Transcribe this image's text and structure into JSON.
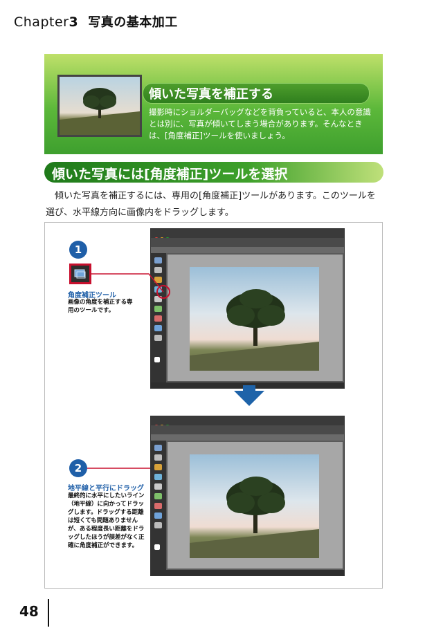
{
  "header": {
    "chapter_label": "Chapter",
    "chapter_number": "3",
    "chapter_title": "写真の基本加工"
  },
  "banner": {
    "title": "傾いた写真を補正する",
    "body": "撮影時にショルダーバッグなどを背負っていると、本人の意識とは別に、写真が傾いてしまう場合があります。そんなときは、[角度補正]ツールを使いましょう。"
  },
  "section": {
    "title": "傾いた写真には[角度補正]ツールを選択",
    "body": "傾いた写真を補正するには、専用の[角度補正]ツールがあります。このツールを選び、水平線方向に画像内をドラッグします。"
  },
  "figure": {
    "step1": {
      "number": "1",
      "title": "角度補正ツール",
      "body": "画像の角度を補正する専用のツールです。"
    },
    "step2": {
      "number": "2",
      "title": "地平線と平行にドラッグ",
      "body": "最終的に水平にしたいライン（地平線）に向かってドラッグします。ドラッグする距離は短くても問題ありませんが、ある程度長い距離をドラッグしたほうが誤差がなく正確に角度補正ができます。"
    }
  },
  "footer": {
    "page_number": "48"
  },
  "colors": {
    "accent_blue": "#1f5fa8",
    "callout_red": "#c8102e",
    "banner_green": "#5cb83a"
  }
}
